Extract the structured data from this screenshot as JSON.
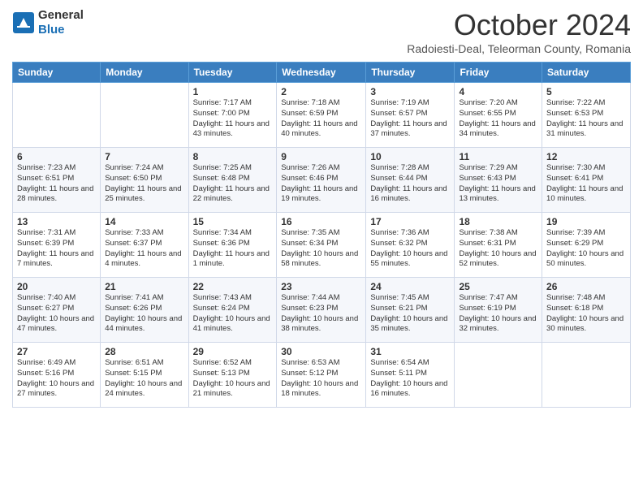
{
  "header": {
    "logo_general": "General",
    "logo_blue": "Blue",
    "month_title": "October 2024",
    "location": "Radoiesti-Deal, Teleorman County, Romania"
  },
  "days_of_week": [
    "Sunday",
    "Monday",
    "Tuesday",
    "Wednesday",
    "Thursday",
    "Friday",
    "Saturday"
  ],
  "weeks": [
    [
      {
        "day": "",
        "info": ""
      },
      {
        "day": "",
        "info": ""
      },
      {
        "day": "1",
        "info": "Sunrise: 7:17 AM\nSunset: 7:00 PM\nDaylight: 11 hours and 43 minutes."
      },
      {
        "day": "2",
        "info": "Sunrise: 7:18 AM\nSunset: 6:59 PM\nDaylight: 11 hours and 40 minutes."
      },
      {
        "day": "3",
        "info": "Sunrise: 7:19 AM\nSunset: 6:57 PM\nDaylight: 11 hours and 37 minutes."
      },
      {
        "day": "4",
        "info": "Sunrise: 7:20 AM\nSunset: 6:55 PM\nDaylight: 11 hours and 34 minutes."
      },
      {
        "day": "5",
        "info": "Sunrise: 7:22 AM\nSunset: 6:53 PM\nDaylight: 11 hours and 31 minutes."
      }
    ],
    [
      {
        "day": "6",
        "info": "Sunrise: 7:23 AM\nSunset: 6:51 PM\nDaylight: 11 hours and 28 minutes."
      },
      {
        "day": "7",
        "info": "Sunrise: 7:24 AM\nSunset: 6:50 PM\nDaylight: 11 hours and 25 minutes."
      },
      {
        "day": "8",
        "info": "Sunrise: 7:25 AM\nSunset: 6:48 PM\nDaylight: 11 hours and 22 minutes."
      },
      {
        "day": "9",
        "info": "Sunrise: 7:26 AM\nSunset: 6:46 PM\nDaylight: 11 hours and 19 minutes."
      },
      {
        "day": "10",
        "info": "Sunrise: 7:28 AM\nSunset: 6:44 PM\nDaylight: 11 hours and 16 minutes."
      },
      {
        "day": "11",
        "info": "Sunrise: 7:29 AM\nSunset: 6:43 PM\nDaylight: 11 hours and 13 minutes."
      },
      {
        "day": "12",
        "info": "Sunrise: 7:30 AM\nSunset: 6:41 PM\nDaylight: 11 hours and 10 minutes."
      }
    ],
    [
      {
        "day": "13",
        "info": "Sunrise: 7:31 AM\nSunset: 6:39 PM\nDaylight: 11 hours and 7 minutes."
      },
      {
        "day": "14",
        "info": "Sunrise: 7:33 AM\nSunset: 6:37 PM\nDaylight: 11 hours and 4 minutes."
      },
      {
        "day": "15",
        "info": "Sunrise: 7:34 AM\nSunset: 6:36 PM\nDaylight: 11 hours and 1 minute."
      },
      {
        "day": "16",
        "info": "Sunrise: 7:35 AM\nSunset: 6:34 PM\nDaylight: 10 hours and 58 minutes."
      },
      {
        "day": "17",
        "info": "Sunrise: 7:36 AM\nSunset: 6:32 PM\nDaylight: 10 hours and 55 minutes."
      },
      {
        "day": "18",
        "info": "Sunrise: 7:38 AM\nSunset: 6:31 PM\nDaylight: 10 hours and 52 minutes."
      },
      {
        "day": "19",
        "info": "Sunrise: 7:39 AM\nSunset: 6:29 PM\nDaylight: 10 hours and 50 minutes."
      }
    ],
    [
      {
        "day": "20",
        "info": "Sunrise: 7:40 AM\nSunset: 6:27 PM\nDaylight: 10 hours and 47 minutes."
      },
      {
        "day": "21",
        "info": "Sunrise: 7:41 AM\nSunset: 6:26 PM\nDaylight: 10 hours and 44 minutes."
      },
      {
        "day": "22",
        "info": "Sunrise: 7:43 AM\nSunset: 6:24 PM\nDaylight: 10 hours and 41 minutes."
      },
      {
        "day": "23",
        "info": "Sunrise: 7:44 AM\nSunset: 6:23 PM\nDaylight: 10 hours and 38 minutes."
      },
      {
        "day": "24",
        "info": "Sunrise: 7:45 AM\nSunset: 6:21 PM\nDaylight: 10 hours and 35 minutes."
      },
      {
        "day": "25",
        "info": "Sunrise: 7:47 AM\nSunset: 6:19 PM\nDaylight: 10 hours and 32 minutes."
      },
      {
        "day": "26",
        "info": "Sunrise: 7:48 AM\nSunset: 6:18 PM\nDaylight: 10 hours and 30 minutes."
      }
    ],
    [
      {
        "day": "27",
        "info": "Sunrise: 6:49 AM\nSunset: 5:16 PM\nDaylight: 10 hours and 27 minutes."
      },
      {
        "day": "28",
        "info": "Sunrise: 6:51 AM\nSunset: 5:15 PM\nDaylight: 10 hours and 24 minutes."
      },
      {
        "day": "29",
        "info": "Sunrise: 6:52 AM\nSunset: 5:13 PM\nDaylight: 10 hours and 21 minutes."
      },
      {
        "day": "30",
        "info": "Sunrise: 6:53 AM\nSunset: 5:12 PM\nDaylight: 10 hours and 18 minutes."
      },
      {
        "day": "31",
        "info": "Sunrise: 6:54 AM\nSunset: 5:11 PM\nDaylight: 10 hours and 16 minutes."
      },
      {
        "day": "",
        "info": ""
      },
      {
        "day": "",
        "info": ""
      }
    ]
  ]
}
